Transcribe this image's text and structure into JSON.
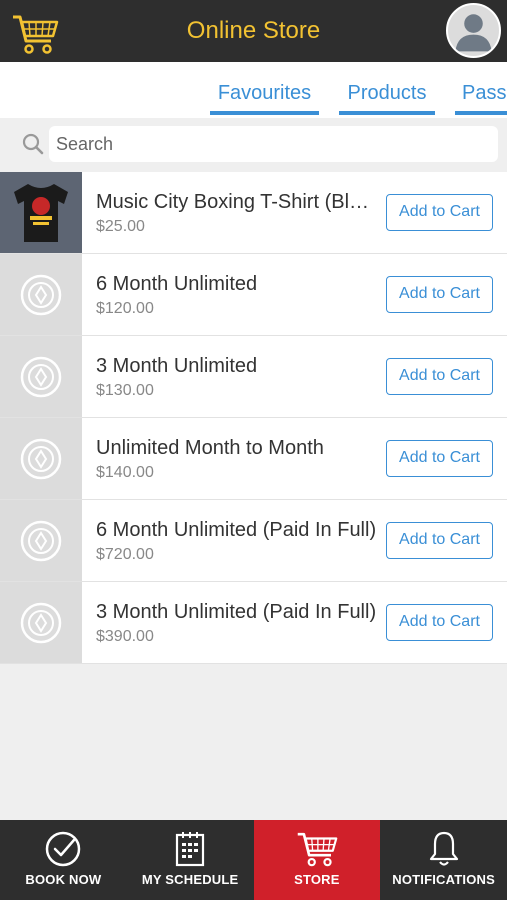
{
  "header": {
    "title": "Online Store",
    "cart_icon": "cart-icon",
    "avatar_icon": "user-avatar-icon",
    "accent_color": "#f2c232"
  },
  "tabs": [
    {
      "label": "Favourites"
    },
    {
      "label": "Products"
    },
    {
      "label": "Passes"
    }
  ],
  "search": {
    "placeholder": "Search",
    "value": ""
  },
  "products": [
    {
      "name": "Music City Boxing T-Shirt (Black)",
      "price": "$25.00",
      "button": "Add to Cart",
      "thumb": "tshirt-image"
    },
    {
      "name": "6 Month Unlimited",
      "price": "$120.00",
      "button": "Add to Cart",
      "thumb": "placeholder-logo"
    },
    {
      "name": "3 Month Unlimited",
      "price": "$130.00",
      "button": "Add to Cart",
      "thumb": "placeholder-logo"
    },
    {
      "name": "Unlimited Month to Month",
      "price": "$140.00",
      "button": "Add to Cart",
      "thumb": "placeholder-logo"
    },
    {
      "name": "6 Month Unlimited (Paid In Full)",
      "price": "$720.00",
      "button": "Add to Cart",
      "thumb": "placeholder-logo"
    },
    {
      "name": "3 Month Unlimited (Paid In Full)",
      "price": "$390.00",
      "button": "Add to Cart",
      "thumb": "placeholder-logo"
    }
  ],
  "nav": [
    {
      "label": "BOOK NOW",
      "icon": "check-circle-icon"
    },
    {
      "label": "MY SCHEDULE",
      "icon": "calendar-icon"
    },
    {
      "label": "STORE",
      "icon": "cart-icon",
      "active": true
    },
    {
      "label": "NOTIFICATIONS",
      "icon": "bell-icon"
    }
  ],
  "colors": {
    "brand_dark": "#2e2e2e",
    "link_blue": "#3a8fd6",
    "active_red": "#d0202a"
  }
}
